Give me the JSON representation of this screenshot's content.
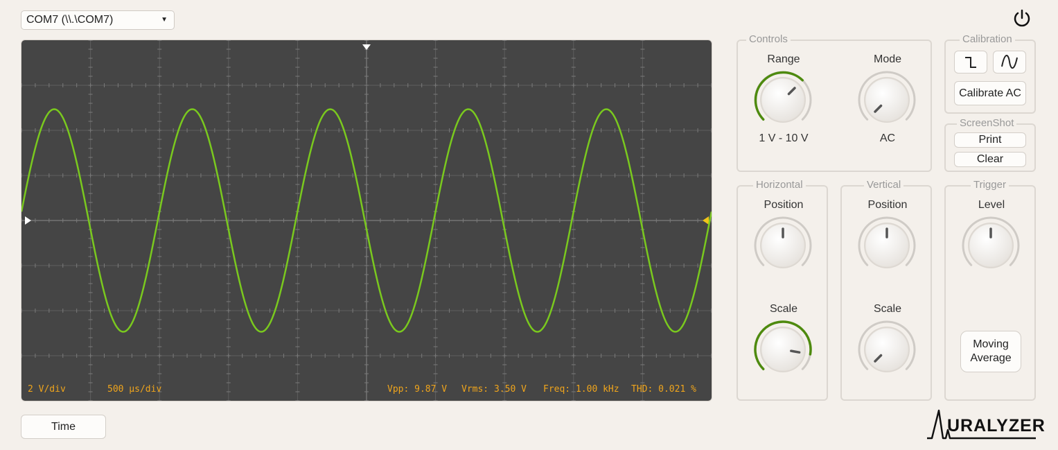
{
  "port_select": {
    "value": "COM7 (\\\\.\\COM7)"
  },
  "scope": {
    "volts_per_div": "2 V/div",
    "time_per_div": "500 µs/div",
    "vpp": "Vpp: 9.87 V",
    "vrms": "Vrms: 3.50 V",
    "freq": "Freq: 1.00 kHz",
    "thd": "THD: 0.021 %",
    "trace_color": "#7ac91e",
    "readout_color": "#f0a51c"
  },
  "time_button": "Time",
  "controls": {
    "title": "Controls",
    "range": {
      "label": "Range",
      "value": "1 V - 10 V"
    },
    "mode": {
      "label": "Mode",
      "value": "AC"
    }
  },
  "calibration": {
    "title": "Calibration",
    "square_icon": "square-wave-icon",
    "sine_icon": "sine-wave-icon",
    "calibrate_label": "Calibrate AC"
  },
  "screenshot": {
    "title": "ScreenShot",
    "print_label": "Print",
    "clear_label": "Clear"
  },
  "horizontal": {
    "title": "Horizontal",
    "position_label": "Position",
    "scale_label": "Scale"
  },
  "vertical": {
    "title": "Vertical",
    "position_label": "Position",
    "scale_label": "Scale"
  },
  "trigger": {
    "title": "Trigger",
    "level_label": "Level",
    "moving_average_line1": "Moving",
    "moving_average_line2": "Average"
  },
  "logo_text": "URALYZER",
  "accent_color": "#4e8a0f"
}
